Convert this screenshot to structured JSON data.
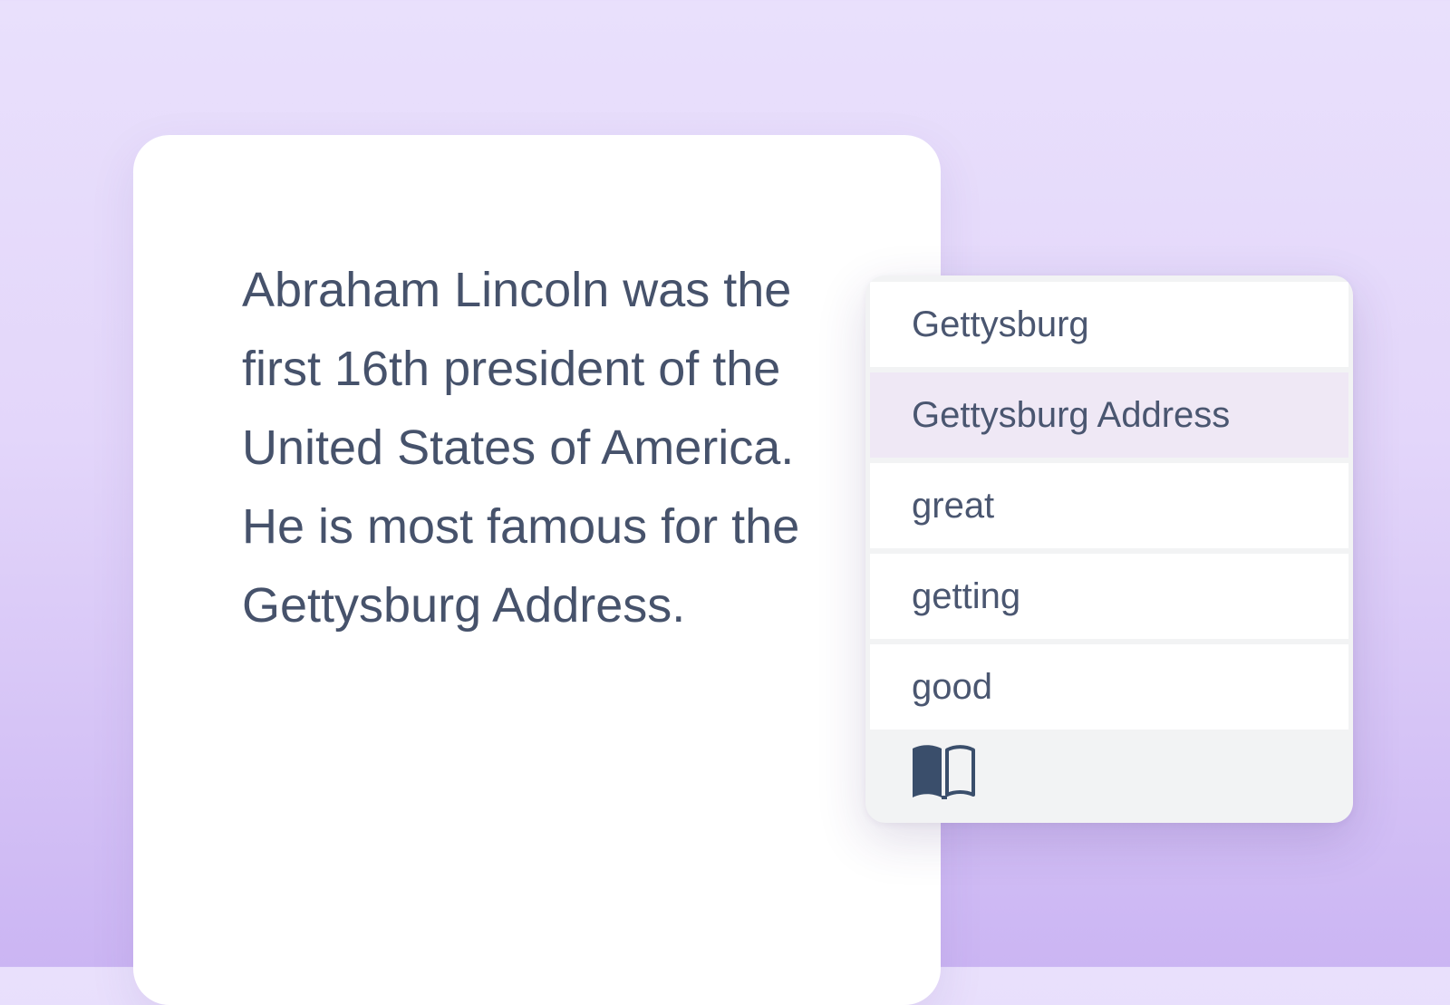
{
  "document": {
    "lines": [
      "Abraham Lincoln was the",
      "first 16th president of the",
      "United States of America.",
      "He is most famous for the",
      "Gettysburg Address."
    ]
  },
  "suggestions": {
    "items": [
      {
        "label": "Gettysburg",
        "selected": false
      },
      {
        "label": "Gettysburg Address",
        "selected": true
      },
      {
        "label": "great",
        "selected": false
      },
      {
        "label": "getting",
        "selected": false
      },
      {
        "label": "good",
        "selected": false
      }
    ],
    "footer_icon": "open-book-icon"
  },
  "colors": {
    "text": "#46526b",
    "selected_row": "#efe8f5",
    "icon": "#3a4e6b"
  }
}
